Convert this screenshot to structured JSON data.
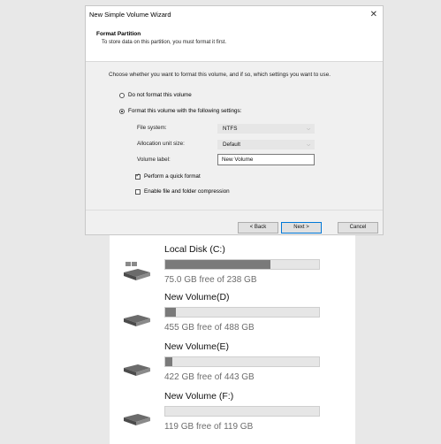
{
  "wizard": {
    "title": "New Simple Volume Wizard",
    "close_glyph": "✕",
    "header_title": "Format Partition",
    "header_subtitle": "To store data on this partition, you must format it first.",
    "instruction": "Choose whether you want to format this volume, and if so, which settings you want to use.",
    "options": {
      "no_format_label": "Do not format this volume",
      "format_label": "Format this volume with the following settings:",
      "selected": "format"
    },
    "settings": {
      "file_system_label": "File system:",
      "file_system_value": "NTFS",
      "allocation_label": "Allocation unit size:",
      "allocation_value": "Default",
      "volume_label_label": "Volume label:",
      "volume_label_value": "New Volume"
    },
    "checks": {
      "quick_format_label": "Perform a quick format",
      "quick_format_checked": true,
      "compression_label": "Enable file and folder compression",
      "compression_checked": false
    },
    "buttons": {
      "back": "< Back",
      "next": "Next >",
      "cancel": "Cancel"
    }
  },
  "drives": [
    {
      "name": "Local Disk (C:)",
      "free_text": "75.0 GB free of 238 GB",
      "used_fraction": 0.685,
      "icon": "windows-drive-icon"
    },
    {
      "name": "New Volume(D)",
      "free_text": "455 GB free of 488 GB",
      "used_fraction": 0.068,
      "icon": "drive-icon"
    },
    {
      "name": "New Volume(E)",
      "free_text": "422 GB free of 443 GB",
      "used_fraction": 0.047,
      "icon": "drive-icon"
    },
    {
      "name": "New Volume (F:)",
      "free_text": "119 GB free of 119 GB",
      "used_fraction": 0.0,
      "icon": "drive-icon"
    }
  ],
  "colors": {
    "bar_fill": "#7a7a7a",
    "bar_bg": "#e6e6e6",
    "primary_border": "#0078d7"
  }
}
